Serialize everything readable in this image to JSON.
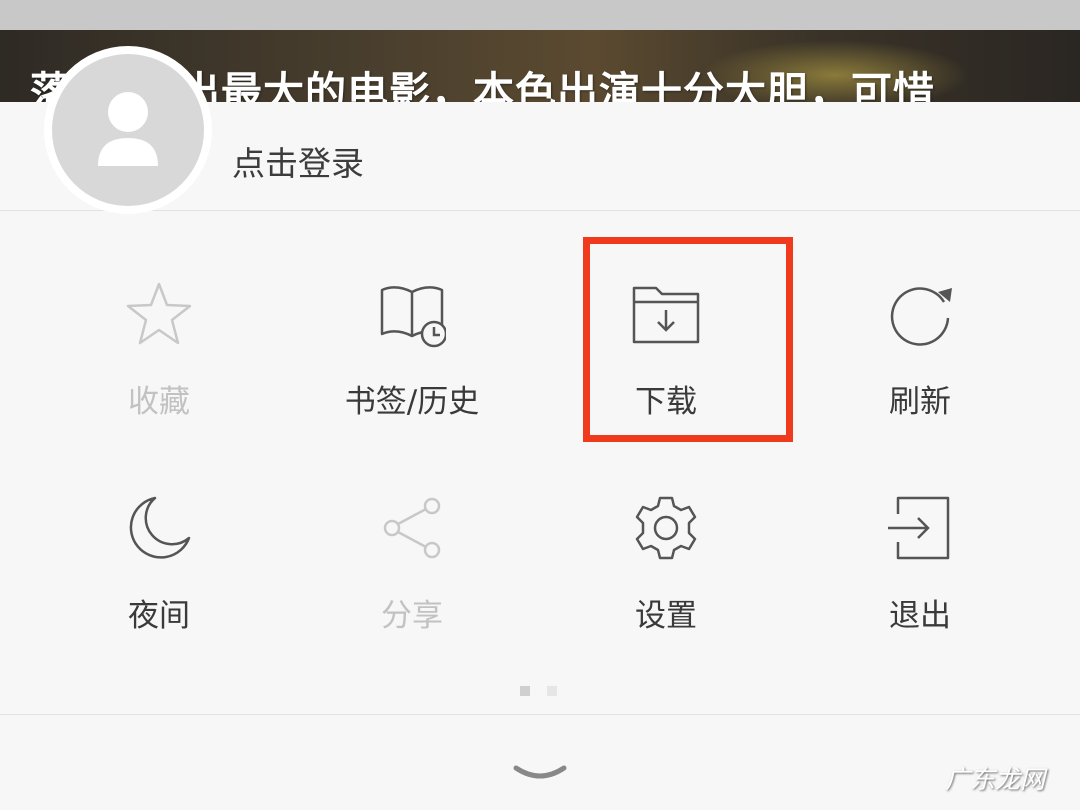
{
  "background_video": {
    "title": "落... 付出最大的电影，本色出演十分大胆，可惜"
  },
  "profile": {
    "login_label": "点击登录",
    "avatar_icon": "user-icon"
  },
  "menu": {
    "items": [
      {
        "label": "收藏",
        "icon": "star-icon",
        "enabled": false
      },
      {
        "label": "书签/历史",
        "icon": "bookmark-history-icon",
        "enabled": true
      },
      {
        "label": "下载",
        "icon": "download-folder-icon",
        "enabled": true,
        "highlighted": true
      },
      {
        "label": "刷新",
        "icon": "refresh-icon",
        "enabled": true
      },
      {
        "label": "夜间",
        "icon": "moon-icon",
        "enabled": true
      },
      {
        "label": "分享",
        "icon": "share-icon",
        "enabled": false
      },
      {
        "label": "设置",
        "icon": "gear-icon",
        "enabled": true
      },
      {
        "label": "退出",
        "icon": "exit-icon",
        "enabled": true
      }
    ],
    "pages": {
      "count": 2,
      "current": 1
    }
  },
  "footer": {
    "collapse_icon": "chevron-down-icon",
    "watermark": "广东龙网"
  },
  "colors": {
    "highlight": "#f03a1e",
    "icon_stroke": "#555555",
    "disabled": "#c2c2c2",
    "panel_bg": "#f7f7f7"
  }
}
